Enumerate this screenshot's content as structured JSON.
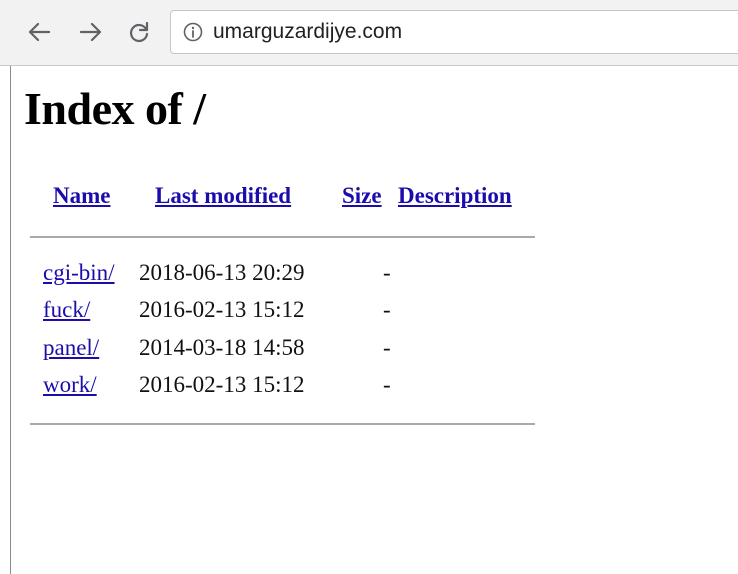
{
  "browser": {
    "back_icon": "arrow-left-icon",
    "forward_icon": "arrow-right-icon",
    "reload_icon": "reload-icon",
    "info_icon": "info-circle-icon",
    "url": "umarguzardijye.com"
  },
  "page": {
    "title": "Index of /",
    "columns": {
      "name": "Name",
      "last_modified": "Last modified",
      "size": "Size",
      "description": "Description"
    },
    "rows": [
      {
        "name": "cgi-bin/",
        "modified": "2018-06-13 20:29",
        "size": "-"
      },
      {
        "name": "fuck/",
        "modified": "2016-02-13 15:12",
        "size": "-"
      },
      {
        "name": "panel/",
        "modified": "2014-03-18 14:58",
        "size": "-"
      },
      {
        "name": "work/",
        "modified": "2016-02-13 15:12",
        "size": "-"
      }
    ],
    "link_color": "#1a0dab"
  }
}
